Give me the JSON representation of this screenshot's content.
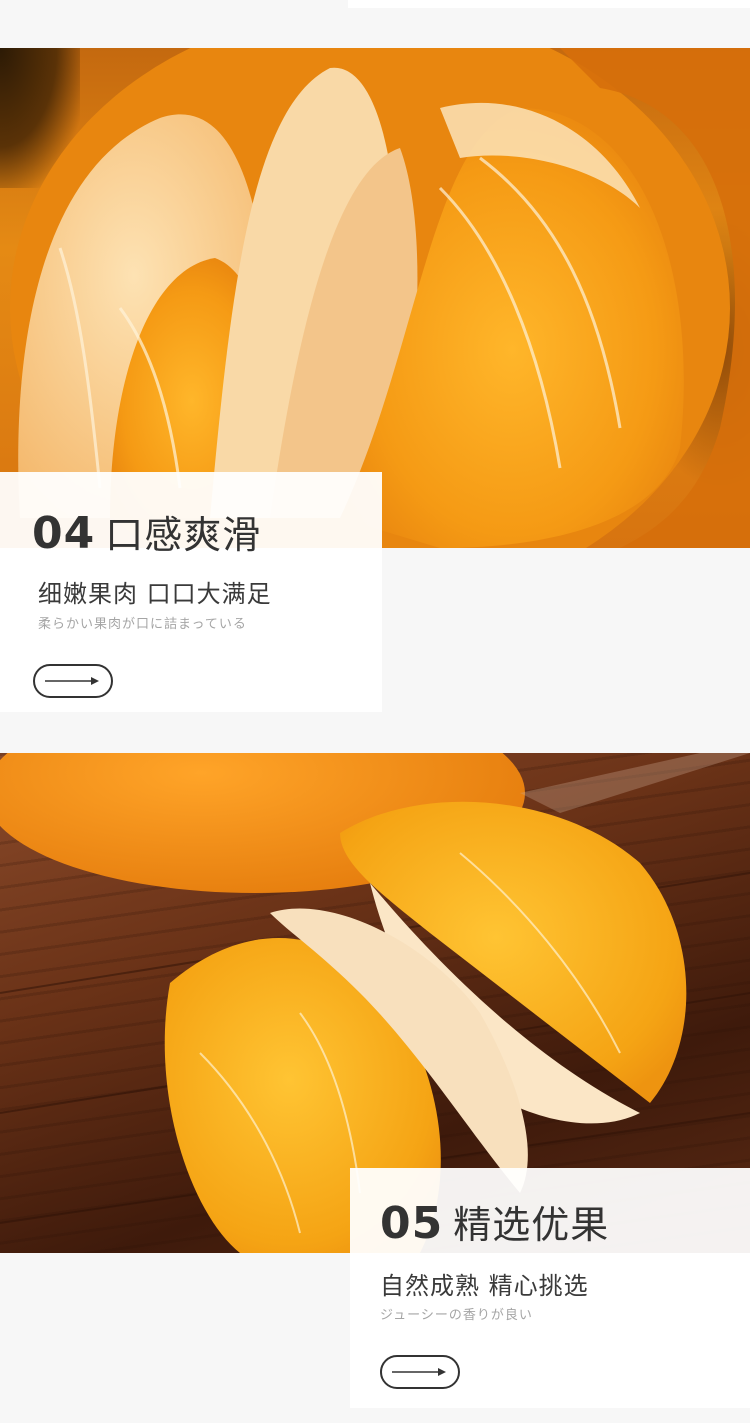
{
  "section4": {
    "number": "04",
    "title": "口感爽滑",
    "subtitle": "细嫩果肉 口口大满足",
    "caption_jp": "柔らかい果肉が口に詰まっている",
    "arrow_icon": "long-arrow-right-icon"
  },
  "section5": {
    "number": "05",
    "title": "精选优果",
    "subtitle": "自然成熟 精心挑选",
    "caption_jp": "ジューシーの香りが良い",
    "arrow_icon": "long-arrow-right-icon"
  },
  "colors": {
    "text_dark": "#333333",
    "text_muted": "#a5a5a5",
    "page_bg": "#f7f7f7",
    "orange": "#f2a516"
  }
}
